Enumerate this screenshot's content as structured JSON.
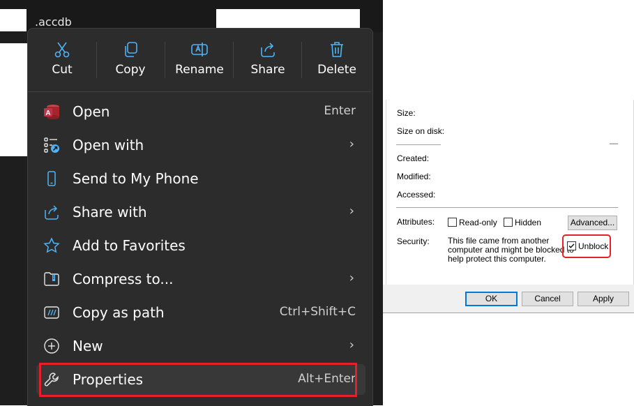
{
  "window": {
    "filename": ".accdb"
  },
  "context_menu": {
    "quick_actions": [
      {
        "label": "Cut",
        "icon": "scissors-icon"
      },
      {
        "label": "Copy",
        "icon": "copy-icon"
      },
      {
        "label": "Rename",
        "icon": "rename-icon"
      },
      {
        "label": "Share",
        "icon": "share-icon"
      },
      {
        "label": "Delete",
        "icon": "trash-icon"
      }
    ],
    "items": [
      {
        "label": "Open",
        "accel": "Enter",
        "icon": "access-app-icon"
      },
      {
        "label": "Open with",
        "submenu": "›",
        "icon": "open-with-icon"
      },
      {
        "label": "Send to My Phone",
        "icon": "phone-icon"
      },
      {
        "label": "Share with",
        "submenu": "›",
        "icon": "share-with-icon"
      },
      {
        "label": "Add to Favorites",
        "icon": "star-icon"
      },
      {
        "label": "Compress to...",
        "submenu": "›",
        "icon": "zip-folder-icon"
      },
      {
        "label": "Copy as path",
        "accel": "Ctrl+Shift+C",
        "icon": "copy-path-icon"
      },
      {
        "label": "New",
        "submenu": "›",
        "icon": "plus-circle-icon"
      },
      {
        "label": "Properties",
        "accel": "Alt+Enter",
        "icon": "wrench-icon"
      }
    ]
  },
  "properties_dialog": {
    "fields": {
      "size": "Size:",
      "size_on_disk": "Size on disk:",
      "created": "Created:",
      "modified": "Modified:",
      "accessed": "Accessed:",
      "attributes": "Attributes:",
      "security": "Security:"
    },
    "attributes": {
      "read_only": "Read-only",
      "hidden": "Hidden",
      "advanced_button": "Advanced..."
    },
    "security_text": [
      "This file came from another",
      "computer and might be blocked to",
      "help protect this computer."
    ],
    "unblock": {
      "label": "Unblock",
      "checked": true
    },
    "buttons": {
      "ok": "OK",
      "cancel": "Cancel",
      "apply": "Apply"
    },
    "dash": "—"
  },
  "colors": {
    "highlight_red": "#e5202a",
    "menu_bg": "#2c2c2c",
    "accent_blue": "#4fb3f6"
  }
}
